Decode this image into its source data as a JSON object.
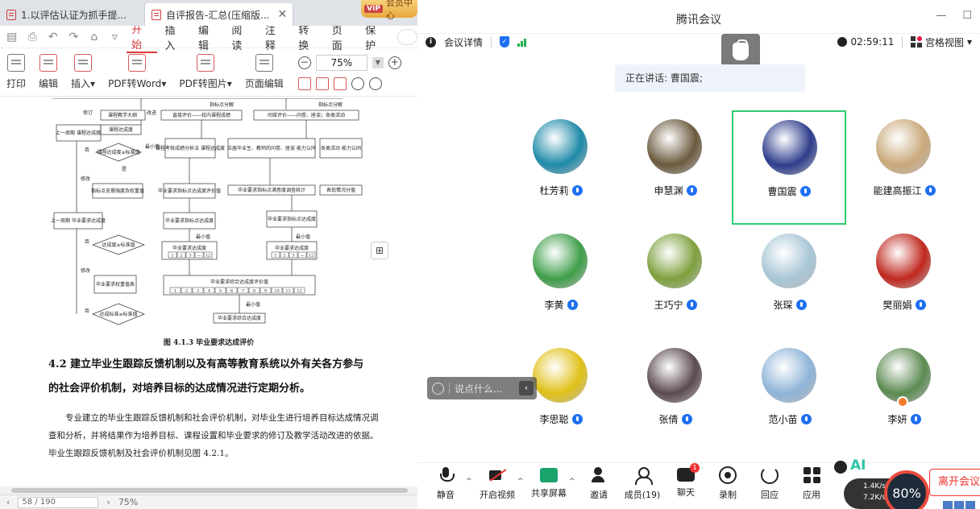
{
  "wps": {
    "tabs": [
      {
        "label": "1.以评估认证为抓手提...",
        "active": false
      },
      {
        "label": "自评报告-汇总(压缩版...",
        "active": true
      }
    ],
    "tab_close": "✕",
    "vip_badge": "VIP",
    "vip_label": "会员中心",
    "menu": [
      "开始",
      "插入",
      "编辑",
      "阅读",
      "注释",
      "转换",
      "页面",
      "保护"
    ],
    "ribbon": [
      {
        "label": "打印",
        "icon": "print-icon"
      },
      {
        "label": "编辑",
        "icon": "edit-icon"
      },
      {
        "label": "插入",
        "icon": "insert-icon",
        "dropdown": true
      },
      {
        "label": "PDF转Word",
        "icon": "pdf-to-word-icon",
        "dropdown": true
      },
      {
        "label": "PDF转图片",
        "icon": "pdf-to-image-icon",
        "dropdown": true
      },
      {
        "label": "页面编辑",
        "icon": "page-edit-icon"
      }
    ],
    "zoom": "75%",
    "figure": {
      "title": "图 4.1.3  毕业要求达成评价",
      "nodes": [
        "课程教学大纲",
        "直接评价——校内课程成绩",
        "间接评价——问卷、座谈；各类活动",
        "上一周期 课程达成度",
        "课程达成度",
        "课程考核成绩分析法 课程达成度",
        "应届毕业生、教师的问卷、座谈 能力认同",
        "各类活动 能力认同",
        "课程达成度≥标准值",
        "指标点支撑强度及权重值",
        "毕业要求指标点达成度评价值",
        "毕业要求指标点满意度调查统计",
        "表现情况分值",
        "上一周期 毕业要求达成度",
        "毕业要求指标点达成度",
        "毕业要求指标点达成度",
        "达成度≥标准值",
        "毕业要求达成度",
        "毕业要求达成度",
        "毕业要求权重值表",
        "毕业要求综合达成度评价值",
        "达成标准≥标准值",
        "毕业要求综合达成度"
      ],
      "labels": [
        "指标点分解",
        "指标点分解",
        "修订",
        "改进",
        "最小值",
        "修改",
        "否",
        "是",
        "最小值",
        "最小值",
        "修改",
        "否",
        "最小值",
        "否"
      ],
      "cells_12": [
        "1",
        "2",
        "3",
        "—",
        "12"
      ],
      "cells_row": [
        "1",
        "2",
        "3",
        "4",
        "5",
        "6",
        "7",
        "8",
        "9",
        "10",
        "11",
        "12"
      ]
    },
    "heading_line1": "4.2 建立毕业生跟踪反馈机制以及有高等教育系统以外有关各方参与",
    "heading_line2": "的社会评价机制，对培养目标的达成情况进行定期分析。",
    "paragraph": "专业建立的毕业生跟踪反馈机制和社会评价机制，对毕业生进行培养目标达成情况调查和分析，并将结果作为培养目标、课程设置和毕业要求的修订及教学活动改进的依据。毕业生跟踪反馈机制及社会评价机制见图 4.2.1。",
    "page_indicator": "58 / 190",
    "zoom_status": "75%"
  },
  "meeting": {
    "title": "腾讯会议",
    "details_label": "会议详情",
    "timer": "02:59:11",
    "view_label": "宫格视图",
    "speaking": "正在讲话: 曹国震;",
    "participants": [
      {
        "name": "杜芳莉",
        "color": "#1f8aa8",
        "active": false
      },
      {
        "name": "申慧渊",
        "color": "#6b5a3e",
        "active": false
      },
      {
        "name": "曹国震",
        "color": "#2e3d8c",
        "active": true
      },
      {
        "name": "能建高振江",
        "color": "#c9a97a",
        "active": false
      },
      {
        "name": "李黄",
        "color": "#3f9e4a",
        "active": false
      },
      {
        "name": "王巧宁",
        "color": "#7ea03e",
        "active": false
      },
      {
        "name": "张琛",
        "color": "#a8c6d6",
        "active": false
      },
      {
        "name": "樊丽娟",
        "color": "#c0281f",
        "active": false
      },
      {
        "name": "李思聪",
        "color": "#e0c018",
        "active": false
      },
      {
        "name": "张倩",
        "color": "#5b4a4e",
        "active": false
      },
      {
        "name": "范小苗",
        "color": "#8fb4d8",
        "active": false
      },
      {
        "name": "李妍",
        "color": "#5c8a52",
        "active": false
      }
    ],
    "chat_placeholder": "说点什么...",
    "toolbar": [
      {
        "label": "静音",
        "icon": "mic"
      },
      {
        "label": "开启视频",
        "icon": "cam"
      },
      {
        "label": "共享屏幕",
        "icon": "share"
      },
      {
        "label": "邀请",
        "icon": "invite"
      },
      {
        "label": "成员(19)",
        "icon": "members"
      },
      {
        "label": "聊天",
        "icon": "chat"
      },
      {
        "label": "录制",
        "icon": "rec"
      },
      {
        "label": "回应",
        "icon": "replay"
      },
      {
        "label": "应用",
        "icon": "apps"
      }
    ],
    "chat_badge": "1",
    "net_up": "1.4K/s",
    "net_down": "7.2K/s",
    "cpu": "80%",
    "ai_label": "AI",
    "leave_label": "离开会议"
  }
}
